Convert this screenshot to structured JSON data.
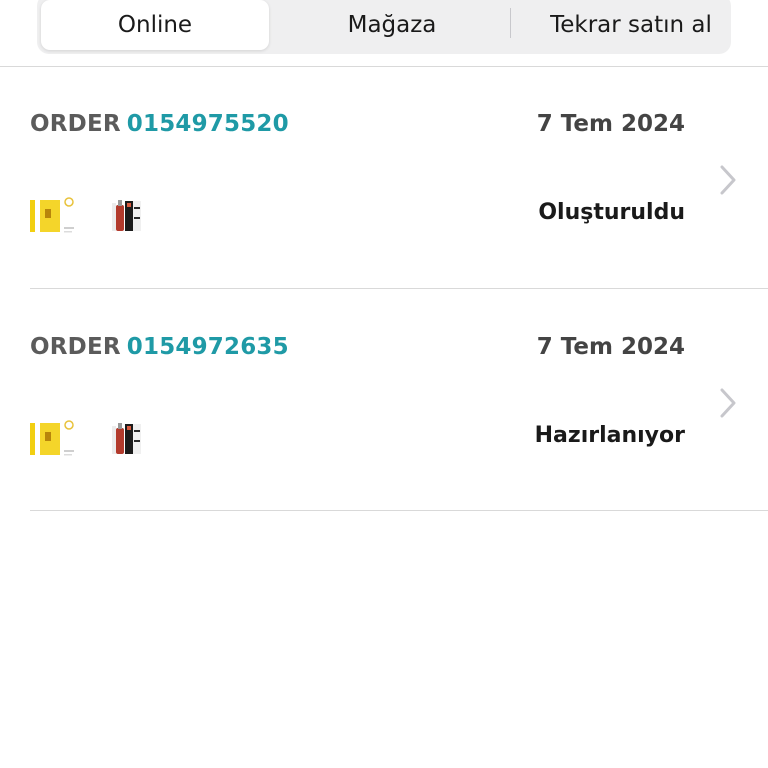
{
  "tabs": [
    {
      "label": "Online",
      "active": true
    },
    {
      "label": "Mağaza",
      "active": false
    },
    {
      "label": "Tekrar satın al",
      "active": false
    }
  ],
  "orders": [
    {
      "order_prefix": "ORDER",
      "order_number": "0154975520",
      "date": "7 Tem 2024",
      "status": "Oluşturuldu"
    },
    {
      "order_prefix": "ORDER",
      "order_number": "0154972635",
      "date": "7 Tem 2024",
      "status": "Hazırlanıyor"
    }
  ],
  "colors": {
    "order_number": "#1f9aa6",
    "chevron": "#c7c7cc"
  },
  "icons": {
    "row_chevron": "chevron-right-icon",
    "product_1": "yellow-product-box-thumbnail",
    "product_2": "red-serum-bottle-thumbnail"
  }
}
